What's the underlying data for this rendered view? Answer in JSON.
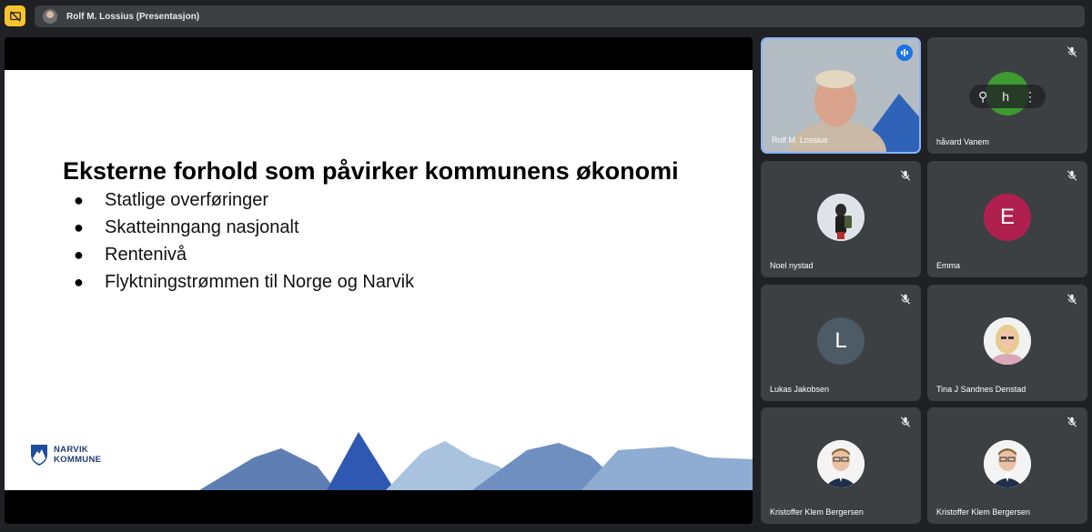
{
  "top_bar": {
    "presenter_label": "Rolf M. Lossius (Presentasjon)"
  },
  "slide": {
    "title": "Eksterne forhold som påvirker kommunens økonomi",
    "bullet_glyph": "●",
    "bullets": [
      "Statlige overføringer",
      "Skatteinngang nasjonalt",
      "Rentenivå",
      "Flyktningstrømmen til Norge og Narvik"
    ],
    "logo_line1": "NARVIK",
    "logo_line2": "KOMMUNE"
  },
  "participants": [
    {
      "name": "Rolf M. Lossius",
      "speaking": true
    },
    {
      "name": "håvard Vanem",
      "initial": "h",
      "avatar_color": "#3d9b30"
    },
    {
      "name": "Noel nystad"
    },
    {
      "name": "Emma",
      "initial": "E",
      "avatar_color": "#b0204f"
    },
    {
      "name": "Lukas Jakobsen",
      "initial": "L",
      "avatar_color": "#4d5b66"
    },
    {
      "name": "Tina J Sandnes Denstad"
    },
    {
      "name": "Kristoffer Klem Bergersen"
    },
    {
      "name": "Kristoffer Klem Bergersen"
    }
  ],
  "hover_controls": {
    "pin_glyph": "⚲",
    "more_glyph": "⋮"
  },
  "colors": {
    "present_button": "#f8c42d",
    "speaking_border": "#8ab4f8",
    "speaking_badge": "#1a73e8",
    "tile_bg": "#3c4043",
    "page_bg": "#202124"
  },
  "icons": [
    "present-off-icon",
    "mic-off-icon",
    "audio-wave-icon",
    "pin-icon",
    "more-vert-icon"
  ]
}
